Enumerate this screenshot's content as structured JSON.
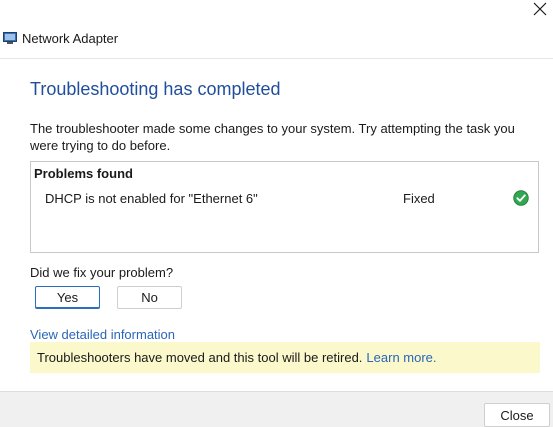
{
  "window": {
    "title": "Network Adapter",
    "close_glyph": "✕",
    "app_icon": "network-adapter-icon"
  },
  "main": {
    "heading": "Troubleshooting has completed",
    "description": "The troubleshooter made some changes to your system. Try attempting the task you were trying to do before.",
    "problems": {
      "header": "Problems found",
      "rows": [
        {
          "text": "DHCP is not enabled for \"Ethernet 6\"",
          "status": "Fixed",
          "status_icon": "check-circle-icon"
        }
      ]
    },
    "question": "Did we fix your problem?",
    "yes_label": "Yes",
    "no_label": "No",
    "details_link": "View detailed information",
    "notice": {
      "text": "Troubleshooters have moved and this tool will be retired.",
      "link": "Learn more."
    }
  },
  "footer": {
    "close_label": "Close"
  },
  "colors": {
    "heading": "#1f4e9c",
    "link": "#2b66b8",
    "notice_bg": "#fbf8cc",
    "footer_bg": "#f0f0f0",
    "check_green": "#2fa84f"
  }
}
